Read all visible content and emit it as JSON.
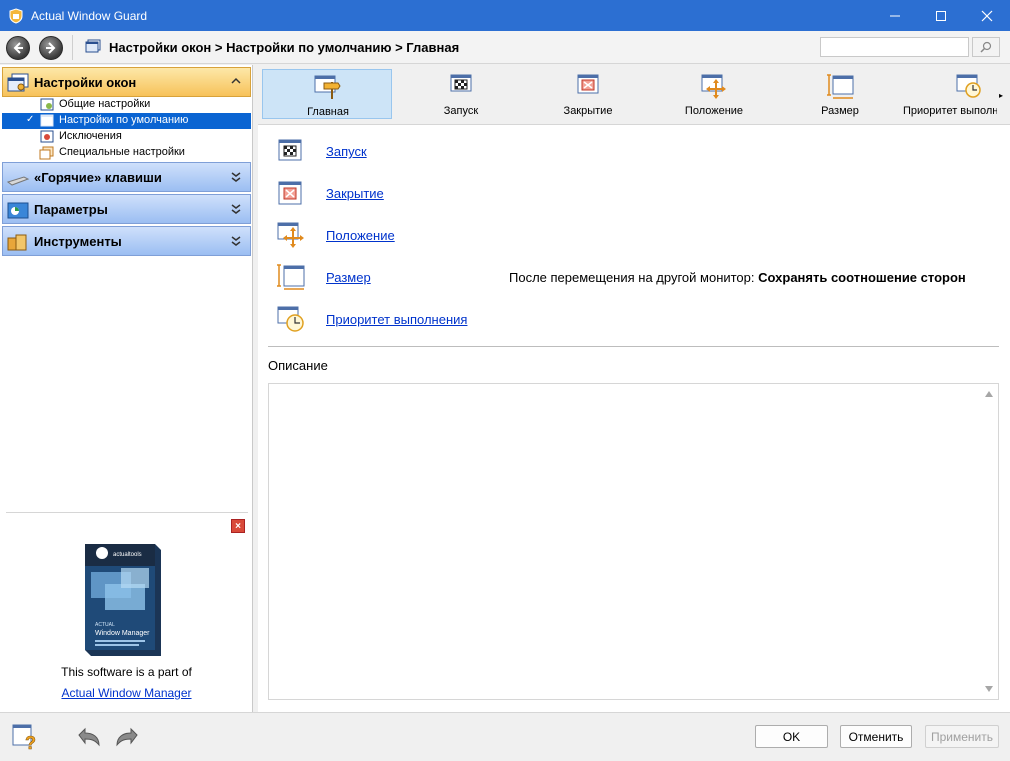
{
  "window": {
    "title": "Actual Window Guard"
  },
  "nav": {
    "breadcrumb": "Настройки окон > Настройки по умолчанию > Главная",
    "search_placeholder": ""
  },
  "sidebar": {
    "categories": [
      {
        "label": "Настройки окон",
        "state": "expanded"
      },
      {
        "label": "«Горячие» клавиши",
        "state": "collapsed"
      },
      {
        "label": "Параметры",
        "state": "collapsed"
      },
      {
        "label": "Инструменты",
        "state": "collapsed"
      }
    ],
    "subitems": [
      {
        "label": "Общие настройки"
      },
      {
        "label": "Настройки по умолчанию",
        "selected": true
      },
      {
        "label": "Исключения"
      },
      {
        "label": "Специальные настройки"
      }
    ],
    "selected_check": "✓"
  },
  "promo": {
    "close_glyph": "×",
    "box_brand": "actualtools",
    "box_title_line1": "ACTUAL",
    "box_title_line2": "Window Manager",
    "text": "This software is a part of",
    "link": "Actual Window Manager"
  },
  "tabs": [
    {
      "label": "Главная",
      "icon": "main-sign-icon",
      "selected": true
    },
    {
      "label": "Запуск",
      "icon": "startup-flag-icon"
    },
    {
      "label": "Закрытие",
      "icon": "close-window-icon"
    },
    {
      "label": "Положение",
      "icon": "move-arrows-icon"
    },
    {
      "label": "Размер",
      "icon": "resize-icon"
    },
    {
      "label": "Приоритет выполнения",
      "icon": "priority-clock-icon"
    }
  ],
  "tab_scroll_glyph": "▸",
  "content": {
    "links": [
      {
        "label": "Запуск",
        "icon": "startup-flag-icon"
      },
      {
        "label": "Закрытие",
        "icon": "close-window-icon"
      },
      {
        "label": "Положение",
        "icon": "move-arrows-icon"
      },
      {
        "label": "Размер",
        "icon": "resize-icon"
      },
      {
        "label": "Приоритет выполнения",
        "icon": "priority-clock-icon"
      }
    ],
    "move_setting_label": "После перемещения на другой монитор:",
    "move_setting_value": "Сохранять соотношение сторон",
    "description_label": "Описание",
    "description_text": ""
  },
  "footer": {
    "ok_label": "OK",
    "cancel_label": "Отменить",
    "apply_label": "Применить"
  },
  "colors": {
    "titlebar": "#2c6fd2",
    "selection": "#0a64d2",
    "link": "#0033cc",
    "active_category": "#f7c25a",
    "category": "#9bbef2"
  }
}
